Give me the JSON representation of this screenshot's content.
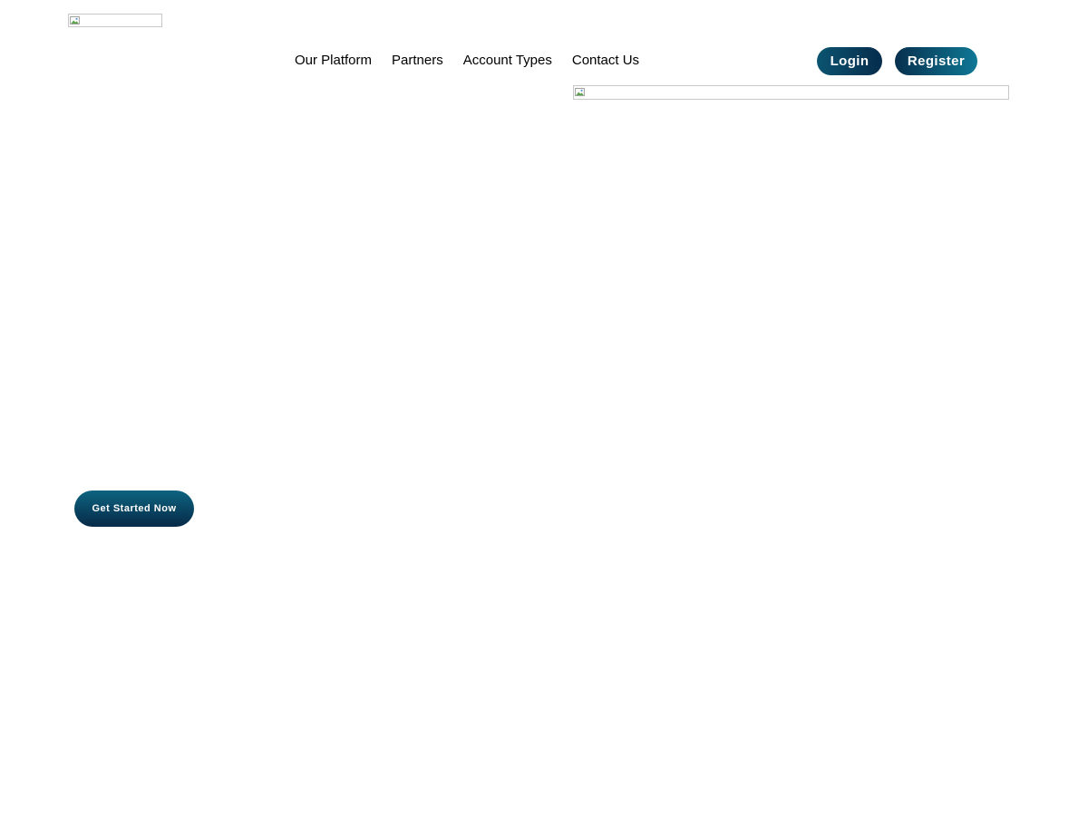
{
  "header": {
    "logo_icon": "broken-image-icon",
    "nav": {
      "items": [
        {
          "label": "Our Platform"
        },
        {
          "label": "Partners"
        },
        {
          "label": "Account Types"
        },
        {
          "label": "Contact Us"
        }
      ]
    },
    "login_label": "Login",
    "register_label": "Register"
  },
  "hero": {
    "image_icon": "broken-image-icon",
    "cta_label": "Get Started Now"
  },
  "colors": {
    "nav_text": "#000000",
    "button_text": "#ffffff",
    "login_gradient": [
      "#0b5470",
      "#062c4c"
    ],
    "register_gradient": [
      "#06304e",
      "#0f7895"
    ],
    "cta_gradient": [
      "#0d6480",
      "#062a48"
    ]
  }
}
